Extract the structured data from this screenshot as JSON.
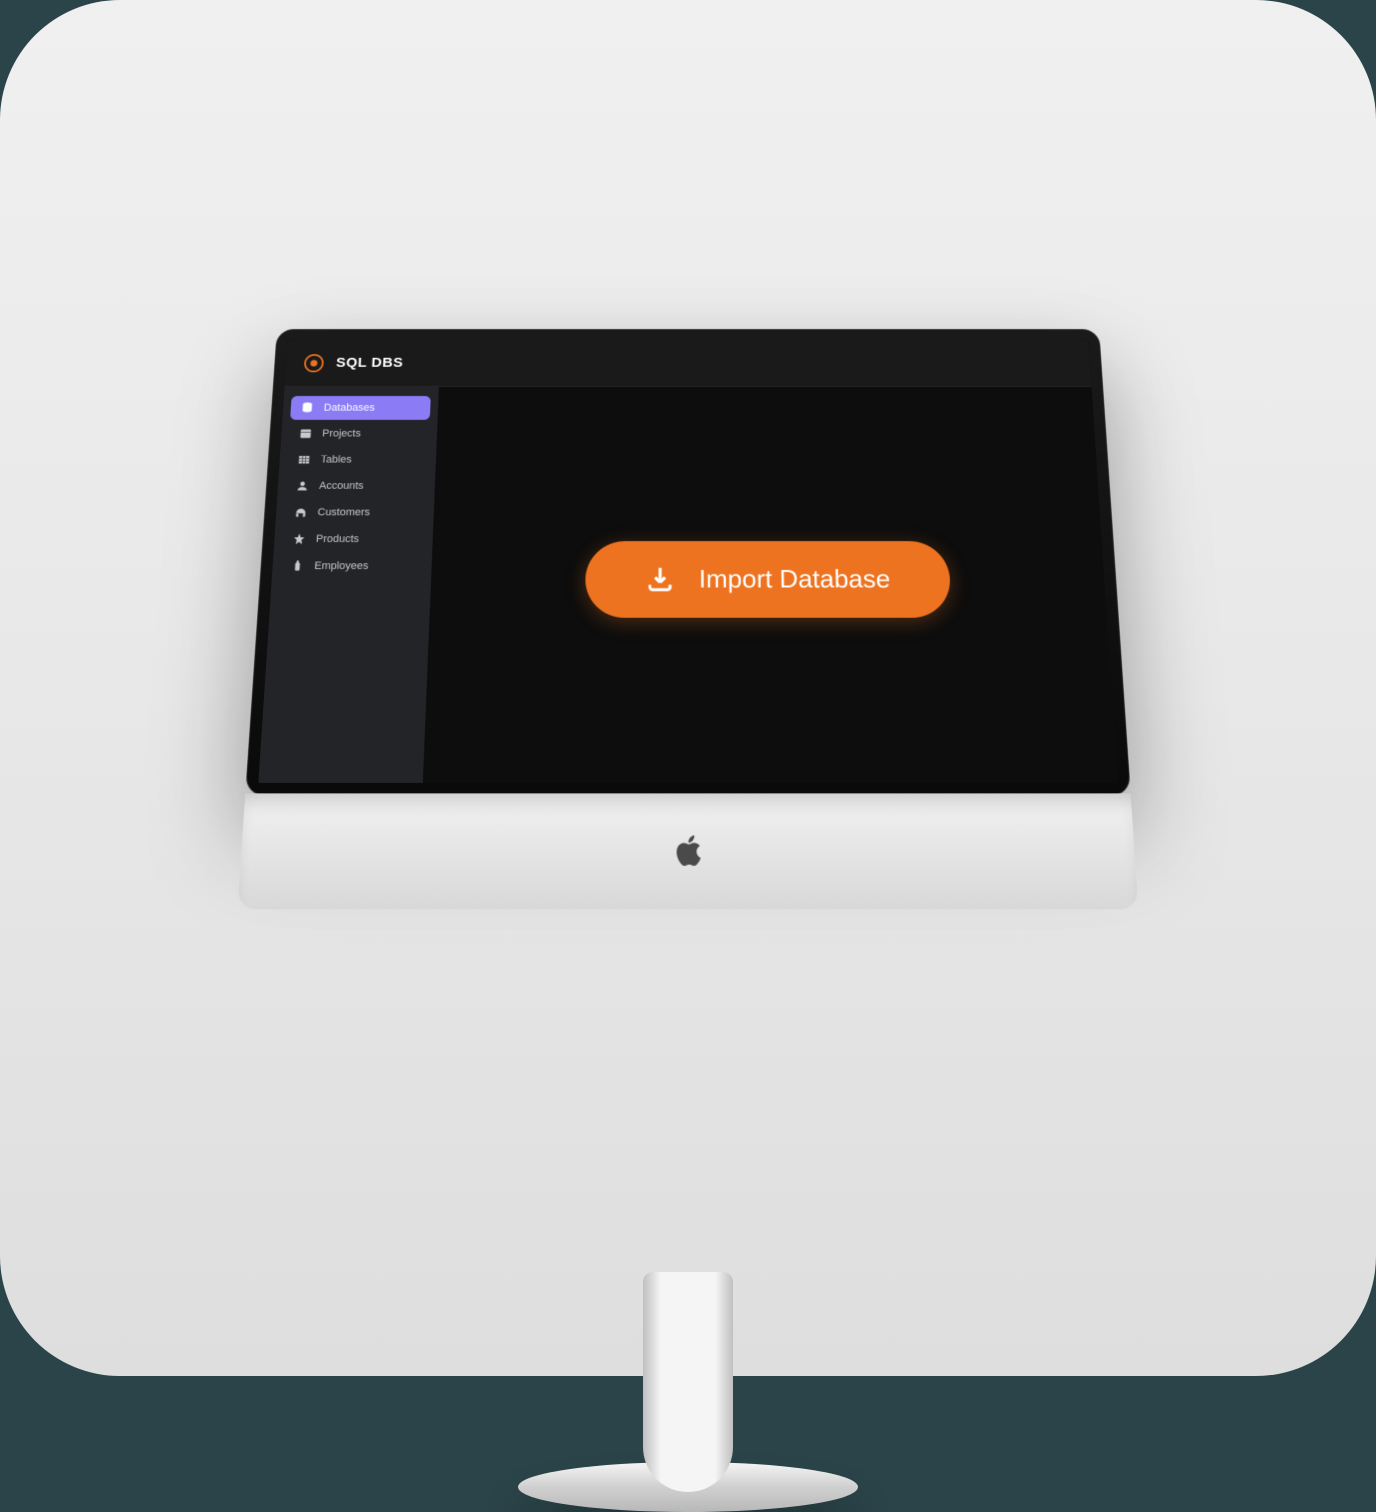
{
  "app": {
    "title": "SQL DBS"
  },
  "sidebar": {
    "items": [
      {
        "label": "Databases",
        "icon": "database-icon",
        "active": true
      },
      {
        "label": "Projects",
        "icon": "projects-icon",
        "active": false
      },
      {
        "label": "Tables",
        "icon": "tables-icon",
        "active": false
      },
      {
        "label": "Accounts",
        "icon": "accounts-icon",
        "active": false
      },
      {
        "label": "Customers",
        "icon": "customers-icon",
        "active": false
      },
      {
        "label": "Products",
        "icon": "products-icon",
        "active": false
      },
      {
        "label": "Employees",
        "icon": "employees-icon",
        "active": false
      }
    ]
  },
  "main": {
    "import_label": "Import Database"
  },
  "colors": {
    "accent_purple": "#8b7cf6",
    "accent_orange": "#ed7320",
    "bg_dark": "#0d0d0d",
    "sidebar_bg": "#222428"
  }
}
